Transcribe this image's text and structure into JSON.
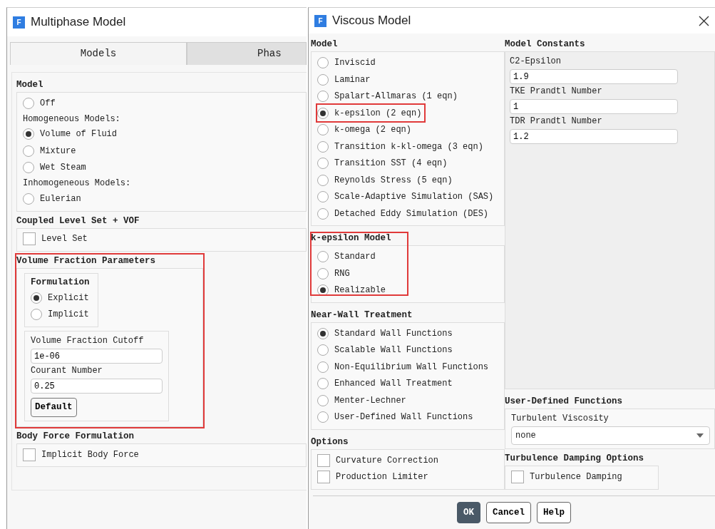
{
  "multiphase_model": {
    "title": "Multiphase Model",
    "icon_letter": "F",
    "tabs": [
      {
        "label": "Models",
        "selected": true
      },
      {
        "label": "Phas",
        "selected": false
      }
    ],
    "groups": [
      {
        "title": "Model",
        "highlighted": false,
        "items": [
          {
            "kind": "radio",
            "label": "Off",
            "selected": false
          },
          {
            "kind": "caption",
            "label": "Homogeneous Models:"
          },
          {
            "kind": "radio",
            "label": "Volume of Fluid",
            "selected": true
          },
          {
            "kind": "radio",
            "label": "Mixture",
            "selected": false
          },
          {
            "kind": "radio",
            "label": "Wet Steam",
            "selected": false
          },
          {
            "kind": "caption",
            "label": "Inhomogeneous Models:"
          },
          {
            "kind": "radio",
            "label": "Eulerian",
            "selected": false
          }
        ]
      },
      {
        "title": "Coupled Level Set + VOF",
        "highlighted": false,
        "items": [
          {
            "kind": "checkbox",
            "label": "Level Set",
            "checked": false
          }
        ]
      },
      {
        "title": "Volume Fraction Parameters",
        "highlighted": true,
        "items": [
          {
            "kind": "subgroup",
            "title": "Formulation",
            "items": [
              {
                "kind": "radio",
                "label": "Explicit",
                "selected": true
              },
              {
                "kind": "radio",
                "label": "Implicit",
                "selected": false
              }
            ]
          },
          {
            "kind": "subgroup",
            "items": [
              {
                "kind": "field",
                "label": "Volume Fraction Cutoff",
                "value": "1e-06"
              },
              {
                "kind": "field",
                "label": "Courant Number",
                "value": "0.25"
              },
              {
                "kind": "button",
                "label": "Default"
              }
            ]
          }
        ]
      },
      {
        "title": "Body Force Formulation",
        "highlighted": false,
        "items": [
          {
            "kind": "checkbox",
            "label": "Implicit Body Force",
            "checked": false
          }
        ]
      }
    ]
  },
  "viscous_model": {
    "title": "Viscous Model",
    "icon_letter": "F",
    "left_column": [
      {
        "title": "Model",
        "highlighted": false,
        "items": [
          {
            "kind": "radio",
            "label": "Inviscid",
            "selected": false,
            "highlighted": false
          },
          {
            "kind": "radio",
            "label": "Laminar",
            "selected": false,
            "highlighted": false
          },
          {
            "kind": "radio",
            "label": "Spalart-Allmaras (1 eqn)",
            "selected": false,
            "highlighted": false
          },
          {
            "kind": "radio",
            "label": "k-epsilon (2 eqn)",
            "selected": true,
            "highlighted": true
          },
          {
            "kind": "radio",
            "label": "k-omega (2 eqn)",
            "selected": false,
            "highlighted": false
          },
          {
            "kind": "radio",
            "label": "Transition k-kl-omega (3 eqn)",
            "selected": false,
            "highlighted": false
          },
          {
            "kind": "radio",
            "label": "Transition SST (4 eqn)",
            "selected": false,
            "highlighted": false
          },
          {
            "kind": "radio",
            "label": "Reynolds Stress (5 eqn)",
            "selected": false,
            "highlighted": false
          },
          {
            "kind": "radio",
            "label": "Scale-Adaptive Simulation (SAS)",
            "selected": false,
            "highlighted": false
          },
          {
            "kind": "radio",
            "label": "Detached Eddy Simulation (DES)",
            "selected": false,
            "highlighted": false
          }
        ]
      },
      {
        "title": "k-epsilon Model",
        "highlighted": true,
        "items": [
          {
            "kind": "radio",
            "label": "Standard",
            "selected": false
          },
          {
            "kind": "radio",
            "label": "RNG",
            "selected": false
          },
          {
            "kind": "radio",
            "label": "Realizable",
            "selected": true
          }
        ]
      },
      {
        "title": "Near-Wall Treatment",
        "highlighted": false,
        "items": [
          {
            "kind": "radio",
            "label": "Standard Wall Functions",
            "selected": true
          },
          {
            "kind": "radio",
            "label": "Scalable Wall Functions",
            "selected": false
          },
          {
            "kind": "radio",
            "label": "Non-Equilibrium Wall Functions",
            "selected": false
          },
          {
            "kind": "radio",
            "label": "Enhanced Wall Treatment",
            "selected": false
          },
          {
            "kind": "radio",
            "label": "Menter-Lechner",
            "selected": false
          },
          {
            "kind": "radio",
            "label": "User-Defined Wall Functions",
            "selected": false
          }
        ]
      },
      {
        "title": "Options",
        "highlighted": false,
        "items": [
          {
            "kind": "checkbox",
            "label": "Curvature Correction",
            "checked": false
          },
          {
            "kind": "checkbox",
            "label": "Production Limiter",
            "checked": false
          }
        ]
      }
    ],
    "right_column": [
      {
        "title": "Model Constants",
        "highlighted": false,
        "kind": "constants",
        "items": [
          {
            "kind": "field",
            "label": "C2-Epsilon",
            "value": "1.9"
          },
          {
            "kind": "field",
            "label": "TKE Prandtl Number",
            "value": "1"
          },
          {
            "kind": "field",
            "label": "TDR Prandtl Number",
            "value": "1.2"
          }
        ]
      },
      {
        "title": "User-Defined Functions",
        "highlighted": false,
        "items": [
          {
            "kind": "dropdown",
            "label": "Turbulent Viscosity",
            "value": "none"
          }
        ]
      },
      {
        "title": "Turbulence Damping Options",
        "highlighted": false,
        "kind": "narrow",
        "items": [
          {
            "kind": "checkbox",
            "label": "Turbulence Damping",
            "checked": false
          }
        ]
      }
    ],
    "buttons": [
      {
        "label": "OK",
        "primary": true
      },
      {
        "label": "Cancel",
        "primary": false
      },
      {
        "label": "Help",
        "primary": false
      }
    ]
  }
}
